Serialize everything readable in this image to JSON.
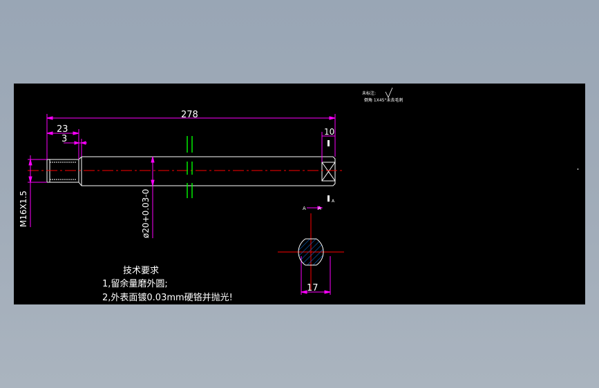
{
  "colors": {
    "background": "#000000",
    "page": "#a1acb9",
    "outline": "#ffffff",
    "dimension": "#ff00ff",
    "centerline": "#ff0000",
    "keyway": "#00ff00",
    "hatch": "#0080ff"
  },
  "dimensions": {
    "overall_length": "278",
    "thread_length": "23",
    "chamfer_length": "3",
    "end_flat": "10",
    "thread_spec": "M16X1.5",
    "diameter_spec": "ø20+0.03-0",
    "section_width": "17"
  },
  "section": {
    "label_left": "A",
    "label_right": "A",
    "arrow_label": "A"
  },
  "roughness_note": {
    "line1": "未标注:",
    "line2": "倒角 1X45°未去毛刺"
  },
  "tech_requirements": {
    "title": "技术要求",
    "item1": "1,留余量磨外圆;",
    "item2": "2,外表面镀0.03mm硬铬并抛光!"
  }
}
